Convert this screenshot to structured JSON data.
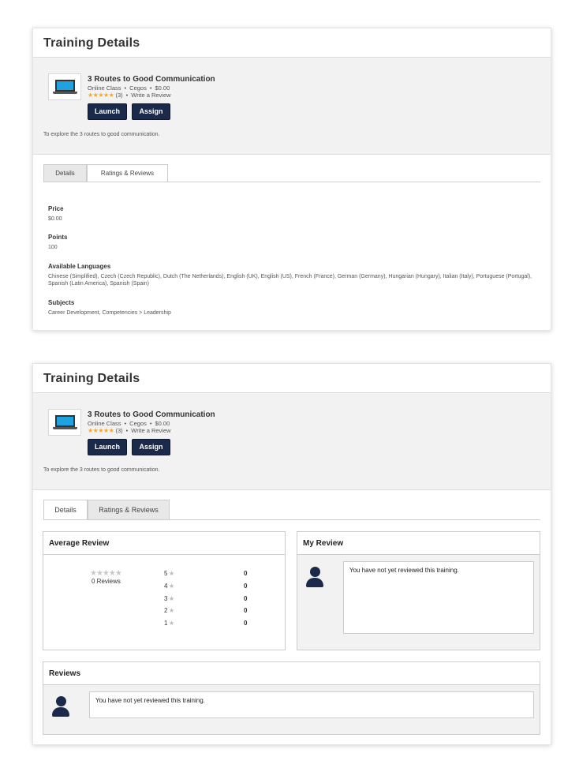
{
  "panel1": {
    "title": "Training Details",
    "course": {
      "title": "3 Routes to Good Communication",
      "type": "Online Class",
      "provider": "Cegos",
      "price": "$0.00",
      "stars": "★★★★★",
      "rating_count": "(3)",
      "write_review": "Write a Review"
    },
    "buttons": {
      "launch": "Launch",
      "assign": "Assign"
    },
    "description": "To explore the 3 routes to good communication.",
    "tabs": {
      "details": "Details",
      "ratings": "Ratings & Reviews",
      "active": "Details"
    },
    "details": [
      {
        "label": "Price",
        "value": "$0.00"
      },
      {
        "label": "Points",
        "value": "100"
      },
      {
        "label": "Available Languages",
        "value": "Chinese (Simplified), Czech (Czech Republic), Dutch (The Netherlands), English (UK), English (US), French (France), German (Germany), Hungarian (Hungary), Italian (Italy), Portuguese (Portugal), Spanish (Latin America), Spanish (Spain)"
      },
      {
        "label": "Subjects",
        "value": "Career Development, Competencies > Leadership"
      }
    ]
  },
  "panel2": {
    "title": "Training Details",
    "course": {
      "title": "3 Routes to Good Communication",
      "type": "Online Class",
      "provider": "Cegos",
      "price": "$0.00",
      "stars": "★★★★★",
      "rating_count": "(3)",
      "write_review": "Write a Review"
    },
    "buttons": {
      "launch": "Launch",
      "assign": "Assign"
    },
    "description": "To explore the 3 routes to good communication.",
    "tabs": {
      "details": "Details",
      "ratings": "Ratings & Reviews",
      "active": "Ratings & Reviews"
    },
    "average_review": {
      "heading": "Average Review",
      "stars": "★★★★★",
      "total": "0 Reviews",
      "rows": [
        {
          "stars": "5",
          "count": "0"
        },
        {
          "stars": "4",
          "count": "0"
        },
        {
          "stars": "3",
          "count": "0"
        },
        {
          "stars": "2",
          "count": "0"
        },
        {
          "stars": "1",
          "count": "0"
        }
      ]
    },
    "my_review": {
      "heading": "My Review",
      "message": "You have not yet reviewed this training."
    },
    "reviews": {
      "heading": "Reviews",
      "message": "You have not yet reviewed this training."
    }
  },
  "colors": {
    "button_bg": "#1b2a4a",
    "star_gold": "#f5a623",
    "star_gray": "#c8c8c8",
    "summary_bg": "#f2f2f2"
  }
}
